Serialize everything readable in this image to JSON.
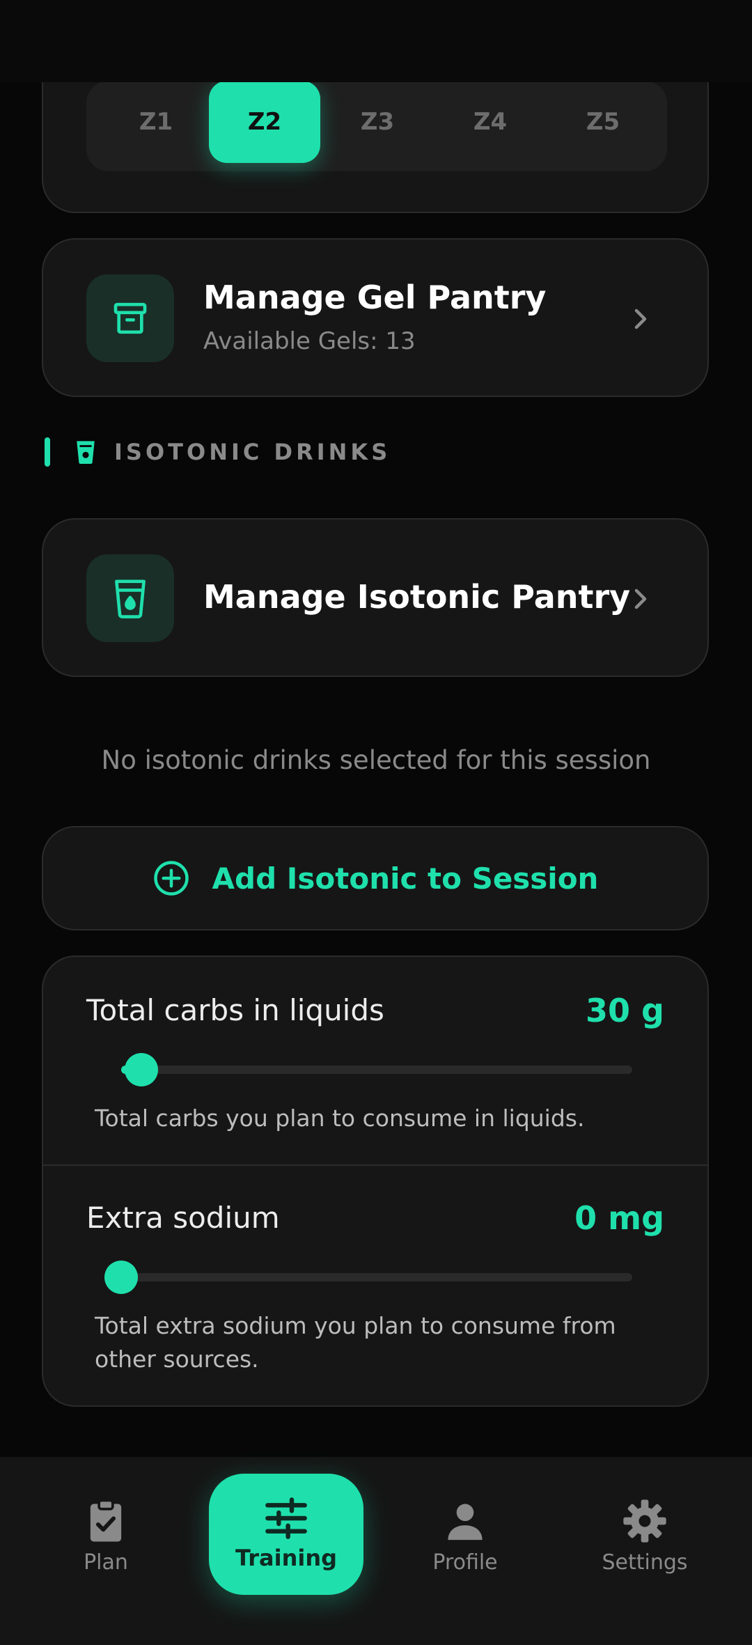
{
  "zones": {
    "items": [
      "Z1",
      "Z2",
      "Z3",
      "Z4",
      "Z5"
    ],
    "selected": "Z2"
  },
  "gel_pantry": {
    "title": "Manage Gel Pantry",
    "subtitle": "Available Gels: 13",
    "icon": "archive-box-icon"
  },
  "isotonic_section": {
    "label": "ISOTONIC DRINKS",
    "icon": "cup-icon"
  },
  "isotonic_pantry": {
    "title": "Manage Isotonic Pantry",
    "icon": "drink-cup-icon"
  },
  "empty_message": "No isotonic drinks selected for this session",
  "add_isotonic": {
    "label": "Add Isotonic to Session",
    "icon": "plus-circle-icon"
  },
  "liquids": {
    "carbs": {
      "title": "Total carbs in liquids",
      "value": "30 g",
      "slider_fraction": 0.04,
      "description": "Total carbs you plan to consume in liquids."
    },
    "sodium": {
      "title": "Extra sodium",
      "value": "0 mg",
      "slider_fraction": 0.0,
      "description": "Total extra sodium you plan to consume from other sources."
    }
  },
  "nav": {
    "plan": "Plan",
    "training": "Training",
    "profile": "Profile",
    "settings": "Settings"
  },
  "colors": {
    "accent": "#1fe0ac",
    "background": "#070707",
    "card": "#161616"
  }
}
